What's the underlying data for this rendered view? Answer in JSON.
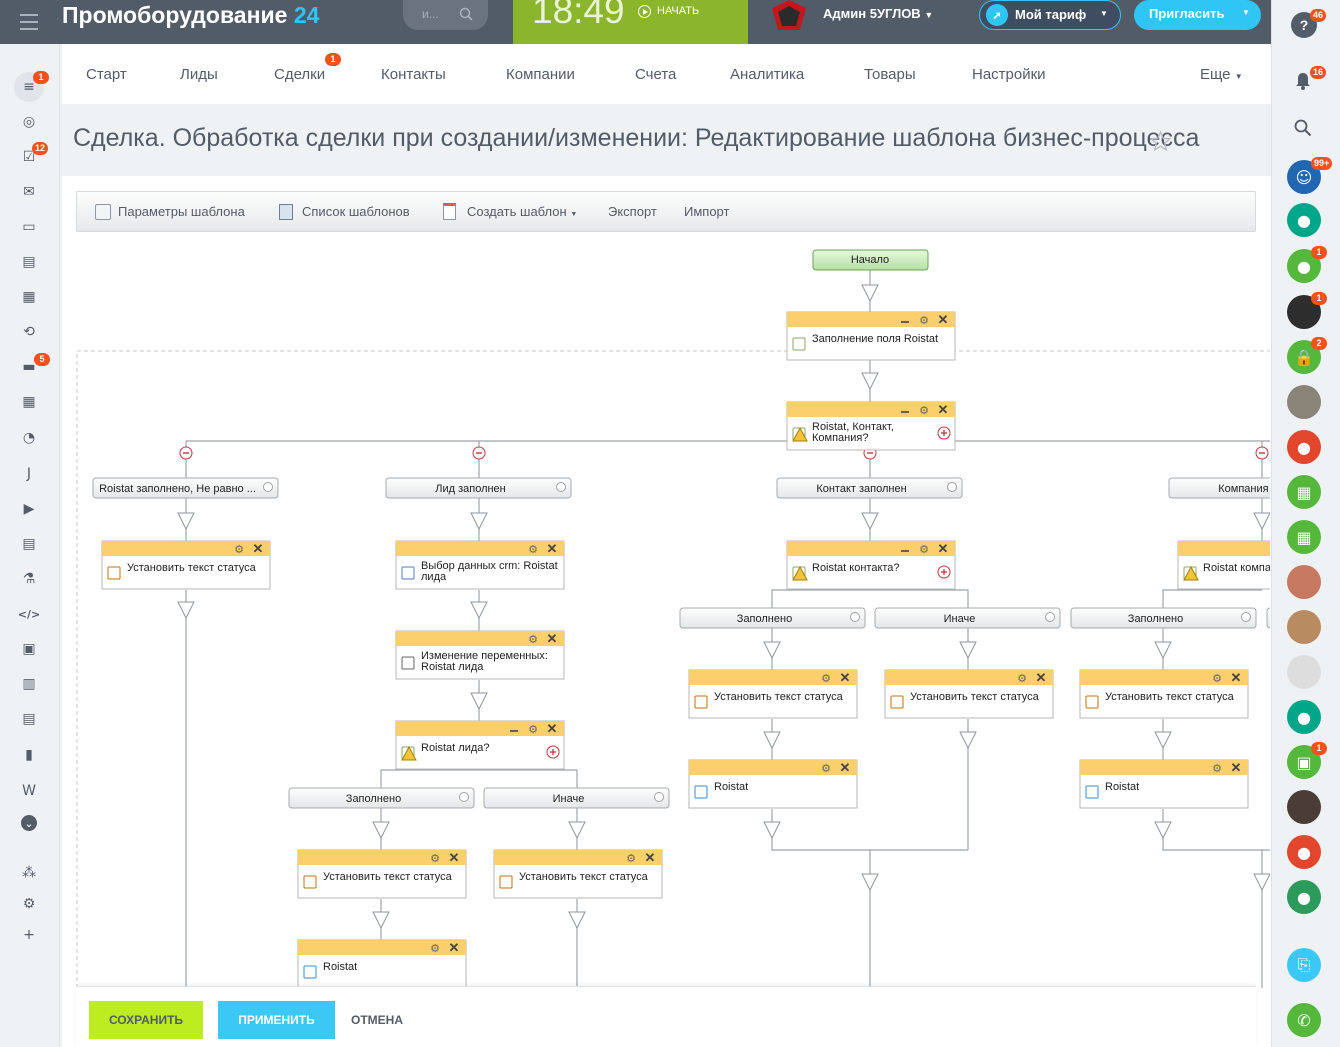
{
  "header": {
    "brand": "Промоборудование",
    "brand_suffix": "24",
    "search_placeholder": "и...",
    "clock": "18:49",
    "start_label": "НАЧАТЬ",
    "user": "Админ 5УГЛОВ",
    "tariff": "Мой тариф",
    "invite": "Пригласить",
    "help_badge": "46"
  },
  "menu": {
    "items": [
      "Старт",
      "Лиды",
      "Сделки",
      "Контакты",
      "Компании",
      "Счета",
      "Аналитика",
      "Товары",
      "Настройки"
    ],
    "more": "Еще",
    "deals_badge": "1"
  },
  "page_title": "Сделка. Обработка сделки при создании/изменении: Редактирование шаблона бизнес-процесса",
  "toolbar": {
    "params": "Параметры шаблона",
    "list": "Список шаблонов",
    "create": "Создать шаблон",
    "export": "Экспорт",
    "import": "Импорт"
  },
  "left_badges": {
    "filter": "1",
    "tasks": "12",
    "chat": "5"
  },
  "left_icons": [
    "filter-icon",
    "target-icon",
    "tasks-icon",
    "mail-icon",
    "calendar-window-icon",
    "contact-card-icon",
    "calendar-icon",
    "sync-icon",
    "chat-icon",
    "apps-icon",
    "clock-icon",
    "j-icon",
    "video-icon",
    "document-icon",
    "lab-icon",
    "code-icon",
    "robot-icon",
    "book-icon",
    "printer-icon",
    "chart-icon",
    "w-icon",
    "chevron-down-icon",
    "sitemap-icon",
    "gear-icon",
    "plus-icon"
  ],
  "right_badges": {
    "notifications": "16",
    "group": "99+",
    "user3": "1",
    "user4": "1",
    "lock": "2",
    "bot": "1"
  },
  "workflow": {
    "start": "Начало",
    "fill_field": "Заполнение поля Roistat",
    "cond_main": [
      "Roistat, Контакт,",
      "Компания?"
    ],
    "branches": [
      "Roistat заполнено, Не равно ...",
      "Лид заполнен",
      "Контакт заполнен",
      "Компания зап"
    ],
    "set_status": "Установить текст статуса",
    "select_data": [
      "Выбор данных crm: Roistat",
      "лида"
    ],
    "change_vars": [
      "Изменение переменных:",
      "Roistat лида"
    ],
    "cond_lead": "Roistat лида?",
    "cond_contact": "Roistat контакта?",
    "cond_company": "Roistat компан",
    "filled": "Заполнено",
    "else": "Иначе",
    "roistat": "Roistat"
  },
  "footer": {
    "save": "СОХРАНИТЬ",
    "apply": "ПРИМЕНИТЬ",
    "cancel": "ОТМЕНА"
  }
}
